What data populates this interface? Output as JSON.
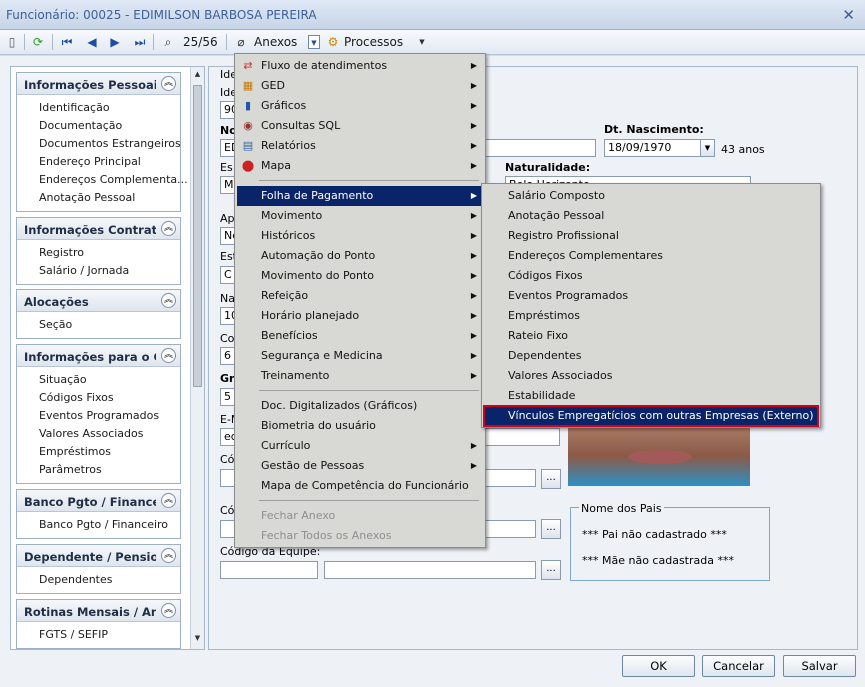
{
  "window": {
    "title": "Funcionário: 00025 - EDIMILSON BARBOSA PEREIRA"
  },
  "toolbar": {
    "record_counter": "25/56",
    "anexos": "Anexos",
    "processos": "Processos"
  },
  "sidebar": {
    "groups": [
      {
        "title": "Informações Pessoais",
        "items": [
          "Identificação",
          "Documentação",
          "Documentos Estrangeiros",
          "Endereço Principal",
          "Endereços Complementa...",
          "Anotação Pessoal"
        ]
      },
      {
        "title": "Informações Contratua",
        "items": [
          "Registro",
          "Salário / Jornada"
        ]
      },
      {
        "title": "Alocações",
        "items": [
          "Seção"
        ]
      },
      {
        "title": "Informações para o Cál",
        "items": [
          "Situação",
          "Códigos Fixos",
          "Eventos Programados",
          "Valores Associados",
          "Empréstimos",
          "Parâmetros"
        ]
      },
      {
        "title": "Banco Pgto / Financeiro",
        "items": [
          "Banco Pgto / Financeiro"
        ]
      },
      {
        "title": "Dependente / Pensionis",
        "items": [
          "Dependentes"
        ]
      },
      {
        "title": "Rotinas Mensais / Anua",
        "items": [
          "FGTS / SEFIP"
        ]
      }
    ]
  },
  "form": {
    "partial_labels": [
      "Ide",
      "Ide",
      "No",
      "Es",
      "Ap",
      "Est",
      "Na",
      "Co",
      "Gr",
      "E-M",
      "Cód",
      "Cód"
    ],
    "partial_values": [
      "90",
      "ED",
      "MC",
      "Ne",
      "C",
      "10",
      "6",
      "5",
      "ed"
    ],
    "dt_nascimento_label": "Dt. Nascimento:",
    "dt_nascimento": "18/09/1970",
    "age": "43 anos",
    "naturalidade_label": "Naturalidade:",
    "naturalidade": "Belo Horizonte",
    "codigo_equipe_label": "Código da Equipe:",
    "pais_caption": "Nome dos Pais",
    "pai": "*** Pai não cadastrado ***",
    "mae": "*** Mãe não cadastrada ***",
    "ellipsis": "..."
  },
  "menu_anexos": {
    "items": [
      "Fluxo de atendimentos",
      "GED",
      "Gráficos",
      "Consultas SQL",
      "Relatórios",
      "Mapa"
    ],
    "items2": [
      "Folha de Pagamento",
      "Movimento",
      "Históricos",
      "Automação do Ponto",
      "Movimento do Ponto",
      "Refeição",
      "Horário planejado",
      "Benefícios",
      "Segurança e Medicina",
      "Treinamento"
    ],
    "items3": [
      "Doc. Digitalizados (Gráficos)",
      "Biometria do usuário",
      "Currículo",
      "Gestão de Pessoas",
      "Mapa de Competência do Funcionário"
    ],
    "disabled": [
      "Fechar Anexo",
      "Fechar Todos os Anexos"
    ]
  },
  "submenu_folha": {
    "items": [
      "Salário Composto",
      "Anotação Pessoal",
      "Registro Profissional",
      "Endereços Complementares",
      "Códigos Fixos",
      "Eventos Programados",
      "Empréstimos",
      "Rateio Fixo",
      "Dependentes",
      "Valores Associados",
      "Estabilidade",
      "Vínculos Empregatícios com outras Empresas (Externo)"
    ]
  },
  "buttons": {
    "ok": "OK",
    "cancel": "Cancelar",
    "save": "Salvar"
  },
  "colors": {
    "menu_highlight": "#0a246a",
    "selection_border": "#d0021b"
  }
}
